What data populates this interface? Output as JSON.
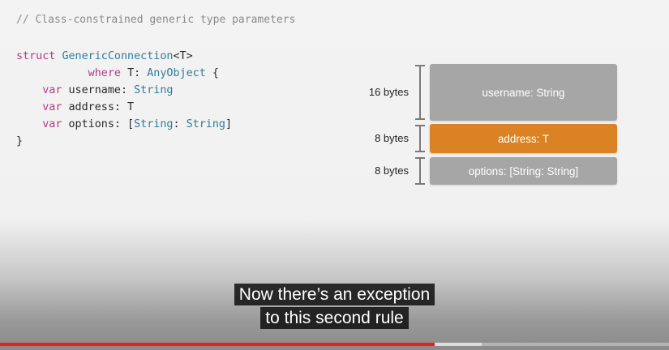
{
  "slide": {
    "comment": "// Class-constrained generic type parameters",
    "code_lines": [
      [
        {
          "t": "struct ",
          "c": "kw"
        },
        {
          "t": "GenericConnection",
          "c": "ty"
        },
        {
          "t": "<T>",
          "c": "tx"
        }
      ],
      [
        {
          "t": "           where ",
          "c": "kw"
        },
        {
          "t": "T: ",
          "c": "tx"
        },
        {
          "t": "AnyObject",
          "c": "ty"
        },
        {
          "t": " {",
          "c": "tx"
        }
      ],
      [
        {
          "t": "    var ",
          "c": "kw"
        },
        {
          "t": "username: ",
          "c": "tx"
        },
        {
          "t": "String",
          "c": "ty"
        }
      ],
      [
        {
          "t": "    var ",
          "c": "kw"
        },
        {
          "t": "address: T",
          "c": "tx"
        }
      ],
      [
        {
          "t": "    var ",
          "c": "kw"
        },
        {
          "t": "options: [",
          "c": "tx"
        },
        {
          "t": "String",
          "c": "ty"
        },
        {
          "t": ": ",
          "c": "tx"
        },
        {
          "t": "String",
          "c": "ty"
        },
        {
          "t": "]",
          "c": "tx"
        }
      ],
      [
        {
          "t": "}",
          "c": "tx"
        }
      ]
    ],
    "memory_layout": [
      {
        "size_label": "16 bytes",
        "field": "username: String",
        "color": "#a6a6a6"
      },
      {
        "size_label": "8 bytes",
        "field": "address: T",
        "color": "#db8324"
      },
      {
        "size_label": "8 bytes",
        "field": "options: [String: String]",
        "color": "#a6a6a6"
      }
    ]
  },
  "caption": {
    "line1": "Now there’s an exception",
    "line2": "to this second rule"
  },
  "player": {
    "progress_fraction": 0.65,
    "buffered_fraction": 0.72
  }
}
